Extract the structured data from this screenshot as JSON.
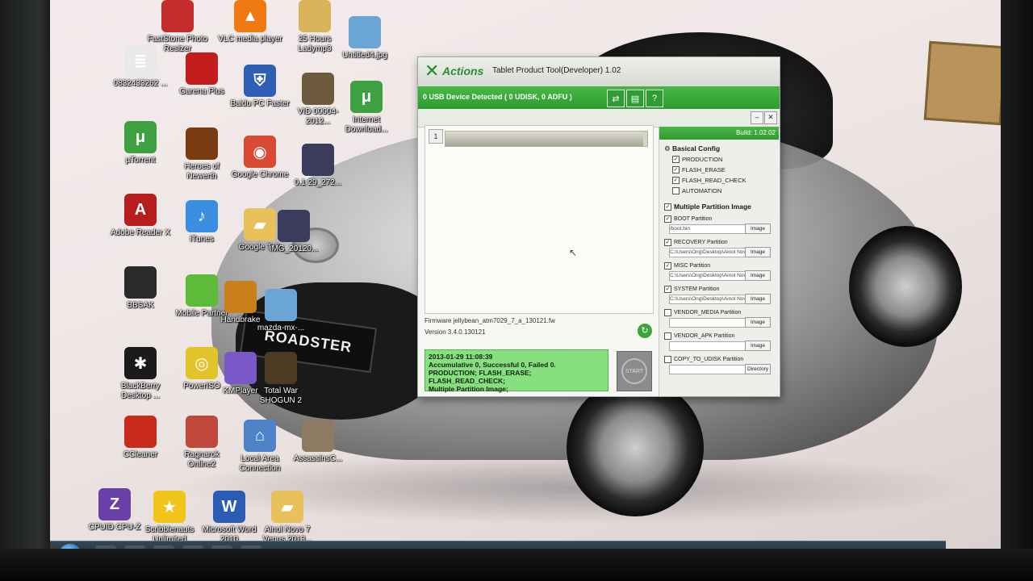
{
  "desktop_icons": [
    {
      "label": "FastStone Photo Resizer",
      "icon": "faststone-icon"
    },
    {
      "label": "VLC media player",
      "icon": "vlc-icon"
    },
    {
      "label": "25 Hours Ladymp3",
      "icon": "music-file-icon"
    },
    {
      "label": "Untitled4.jpg",
      "icon": "image-file-icon"
    },
    {
      "label": "0832433262 ...",
      "icon": "text-file-icon"
    },
    {
      "label": "Garena Plus",
      "icon": "garena-icon"
    },
    {
      "label": "Baidu PC Faster",
      "icon": "shield-icon"
    },
    {
      "label": "VID 00004-2012...",
      "icon": "video-file-icon"
    },
    {
      "label": "Internet Download...",
      "icon": "utorrent-icon"
    },
    {
      "label": "µTorrent",
      "icon": "utorrent-icon"
    },
    {
      "label": "Heroes of Newerth",
      "icon": "hon-icon"
    },
    {
      "label": "Google Chrome",
      "icon": "chrome-icon"
    },
    {
      "label": "0.1 29_272...",
      "icon": "photo-file-icon"
    },
    {
      "label": "Adobe Reader X",
      "icon": "adobe-reader-icon"
    },
    {
      "label": "iTunes",
      "icon": "itunes-icon"
    },
    {
      "label": "Google Talk",
      "icon": "folder-icon"
    },
    {
      "label": "IMG_20120...",
      "icon": "photo-file-icon"
    },
    {
      "label": "BBSAK",
      "icon": "bbsak-icon"
    },
    {
      "label": "Mobile Partner",
      "icon": "mobile-partner-icon"
    },
    {
      "label": "Handbrake",
      "icon": "handbrake-icon"
    },
    {
      "label": "mazda-mx-...",
      "icon": "image-file-icon"
    },
    {
      "label": "BlackBerry Desktop ...",
      "icon": "blackberry-icon"
    },
    {
      "label": "PowerISO",
      "icon": "poweriso-icon"
    },
    {
      "label": "KMPlayer",
      "icon": "kmplayer-icon"
    },
    {
      "label": "Total War SHOGUN 2",
      "icon": "shogun-icon"
    },
    {
      "label": "CCleaner",
      "icon": "ccleaner-icon"
    },
    {
      "label": "Ragnarok Online2",
      "icon": "ragnarok-icon"
    },
    {
      "label": "Local Area Connection",
      "icon": "network-icon"
    },
    {
      "label": "AssassinsC...",
      "icon": "assassins-creed-icon"
    },
    {
      "label": "CPUID CPU-Z",
      "icon": "cpuz-icon"
    },
    {
      "label": "Scribblenauts Unlimited",
      "icon": "star-icon"
    },
    {
      "label": "Microsoft Word 2010",
      "icon": "word-icon"
    },
    {
      "label": "Ainol Novo 7 Venus 2013...",
      "icon": "folder-icon"
    }
  ],
  "plate_text": "ROADSTER",
  "app": {
    "brand": "Actions",
    "title": "Tablet Product Tool(Developer) 1.02",
    "device_status": "0 USB Device Detected ( 0 UDISK, 0 ADFU )",
    "slot_number": "1",
    "build": "Build: 1.02.02",
    "firmware_label": "Firmware",
    "firmware_value": "jellybean_atm7029_7_a_130121.fw",
    "version_label": "Version",
    "version_value": "3.4.0.130121",
    "log_lines": [
      "2013-01-29 11:08:39",
      "Accumulative 0, Successful 0, Failed 0.",
      "PRODUCTION; FLASH_ERASE; FLASH_READ_CHECK;",
      "Multiple Partition Image;"
    ],
    "start_label": "START",
    "basic_config_label": "Basical Config",
    "options": [
      {
        "label": "PRODUCTION",
        "checked": true
      },
      {
        "label": "FLASH_ERASE",
        "checked": true
      },
      {
        "label": "FLASH_READ_CHECK",
        "checked": true
      },
      {
        "label": "AUTOMATION",
        "checked": false
      }
    ],
    "multi_partition_label": "Multiple Partition Image",
    "partitions": [
      {
        "label": "BOOT Partition",
        "path": "/boot.bin",
        "button": "Image",
        "checked": true
      },
      {
        "label": "RECOVERY Partition",
        "path": "C:\\Users\\Ong\\Desktop\\Ainol Novo 7 Venus",
        "button": "Image",
        "checked": true
      },
      {
        "label": "MISC Partition",
        "path": "C:\\Users\\Ong\\Desktop\\Ainol Novo 7 Venus",
        "button": "Image",
        "checked": true
      },
      {
        "label": "SYSTEM Partition",
        "path": "C:\\Users\\Ong\\Desktop\\Ainol Novo 7 Venus",
        "button": "Image",
        "checked": true
      },
      {
        "label": "VENDOR_MEDIA Partition",
        "path": "",
        "button": "Image",
        "checked": false
      },
      {
        "label": "VENDOR_APK Partition",
        "path": "",
        "button": "Image",
        "checked": false
      },
      {
        "label": "COPY_TO_UDISK Partition",
        "path": "",
        "button": "Directory",
        "checked": false
      }
    ],
    "progress": 0.98
  },
  "colors": {
    "accent_green": "#2e9a2f",
    "log_green": "#86e07e",
    "taskbar": "#1d2833"
  }
}
